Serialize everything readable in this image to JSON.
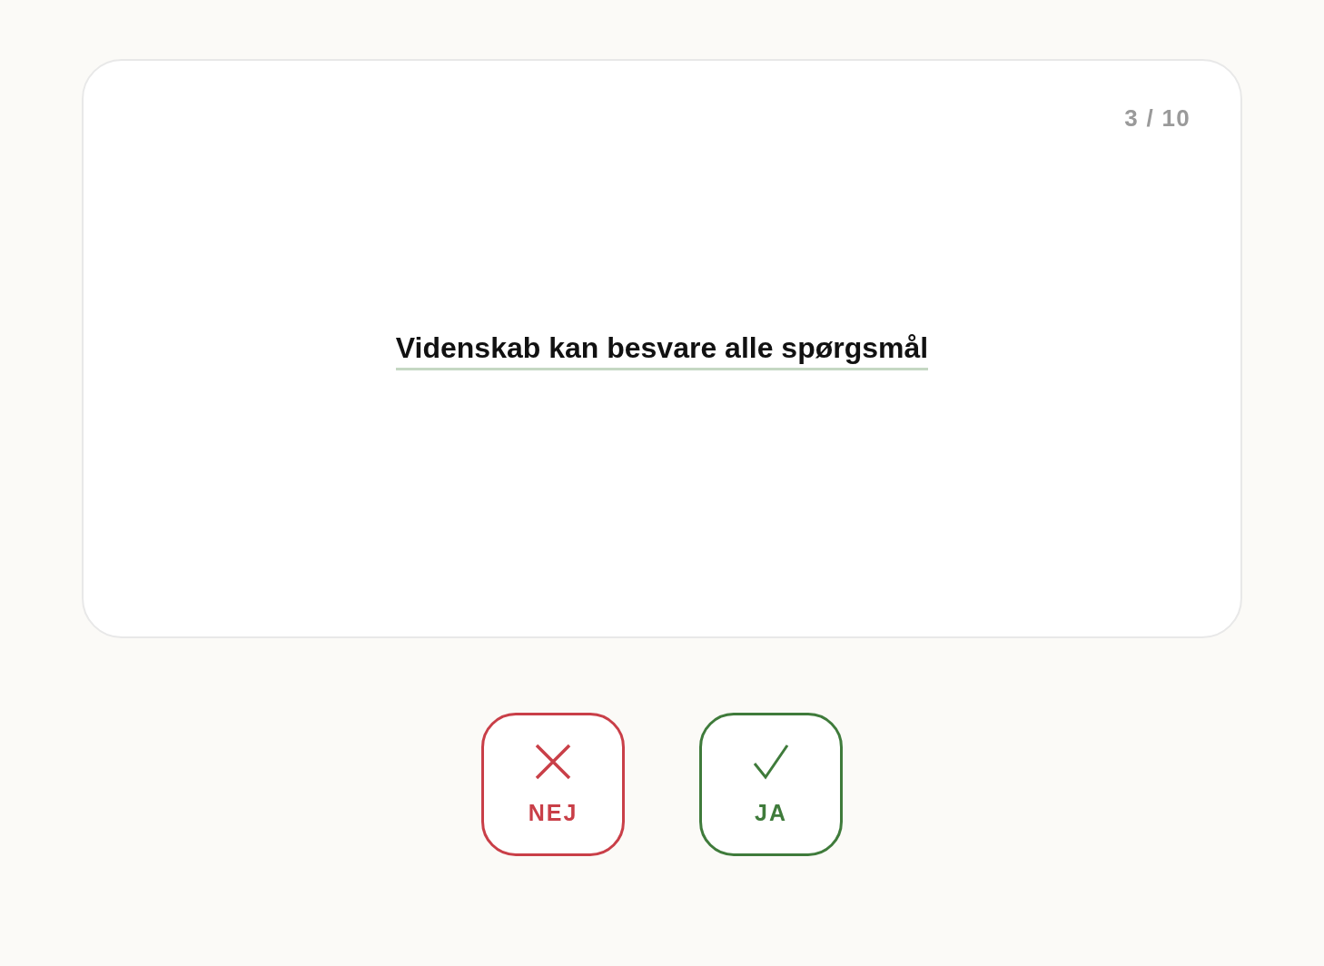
{
  "card": {
    "counter": "3 / 10",
    "statement": "Videnskab kan besvare alle spørgsmål"
  },
  "buttons": [
    {
      "kind": "no",
      "label": "NEJ"
    },
    {
      "kind": "yes",
      "label": "JA"
    }
  ]
}
